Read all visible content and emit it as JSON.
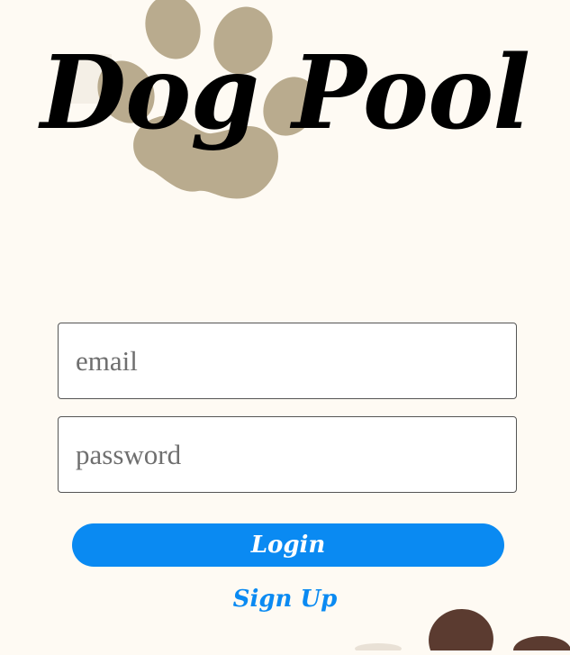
{
  "app": {
    "title": "Dog Pool"
  },
  "form": {
    "email": {
      "placeholder": "email",
      "value": ""
    },
    "password": {
      "placeholder": "password",
      "value": ""
    },
    "login_label": "Login",
    "signup_label": "Sign Up"
  },
  "colors": {
    "background": "#fefaf3",
    "accent": "#0a8af2",
    "paw_light": "#b9ab8e",
    "paw_dark": "#5b3b30"
  },
  "icons": {
    "top_decoration": "paw-print-icon",
    "bottom_decoration": "paw-print-icon"
  }
}
